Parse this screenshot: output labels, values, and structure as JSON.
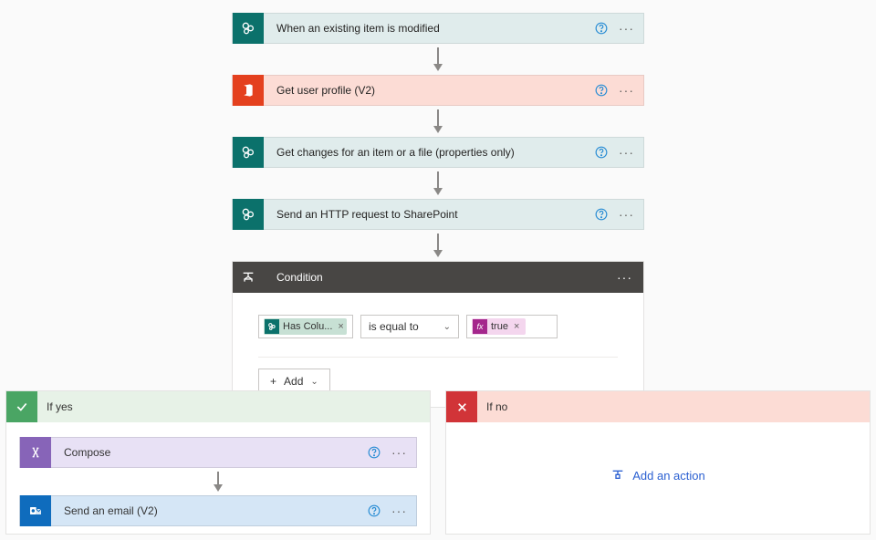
{
  "steps": {
    "trigger": {
      "label": "When an existing item is modified"
    },
    "getUser": {
      "label": "Get user profile (V2)"
    },
    "getChanges": {
      "label": "Get changes for an item or a file (properties only)"
    },
    "httpReq": {
      "label": "Send an HTTP request to SharePoint"
    }
  },
  "condition": {
    "title": "Condition",
    "leftToken": "Has Colu...",
    "operator": "is equal to",
    "rightToken": "true",
    "addLabel": "Add"
  },
  "branches": {
    "yes": {
      "label": "If yes",
      "compose": {
        "label": "Compose"
      },
      "email": {
        "label": "Send an email (V2)"
      }
    },
    "no": {
      "label": "If no",
      "addAction": "Add an action"
    }
  }
}
